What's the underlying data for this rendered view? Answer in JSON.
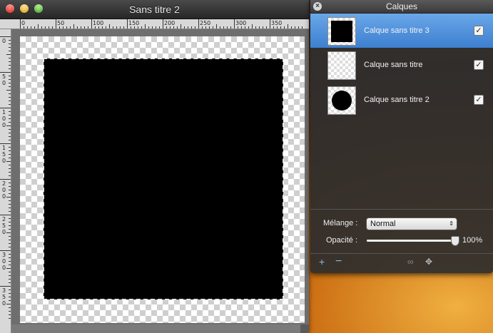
{
  "document": {
    "title": "Sans titre 2",
    "ruler_top_labels": [
      "0",
      "50",
      "100",
      "150",
      "200",
      "250",
      "300",
      "350"
    ],
    "ruler_left_labels": [
      "0",
      "50",
      "100",
      "150",
      "200",
      "250",
      "300",
      "350"
    ]
  },
  "layers_panel": {
    "title": "Calques",
    "layers": [
      {
        "name": "Calque sans titre 3",
        "visible": true,
        "selected": true,
        "thumb": "black-square"
      },
      {
        "name": "Calque sans titre",
        "visible": true,
        "selected": false,
        "thumb": "empty"
      },
      {
        "name": "Calque sans titre 2",
        "visible": true,
        "selected": false,
        "thumb": "black-circle"
      }
    ],
    "blend_label": "Mélange :",
    "blend_value": "Normal",
    "opacity_label": "Opacité :",
    "opacity_value": "100%",
    "opacity_fraction": 1.0,
    "footer_icons": [
      "plus-icon",
      "minus-icon",
      "link-icon",
      "move-icon"
    ],
    "footer": {
      "add": "+",
      "remove": "−",
      "link": "∞",
      "move": "✥"
    },
    "close_glyph": "×",
    "check_glyph": "✓",
    "select_arrows": "⇕"
  },
  "colors": {
    "selection_blue": "#3d7fd0",
    "panel_bg": "#2d2d2d"
  }
}
